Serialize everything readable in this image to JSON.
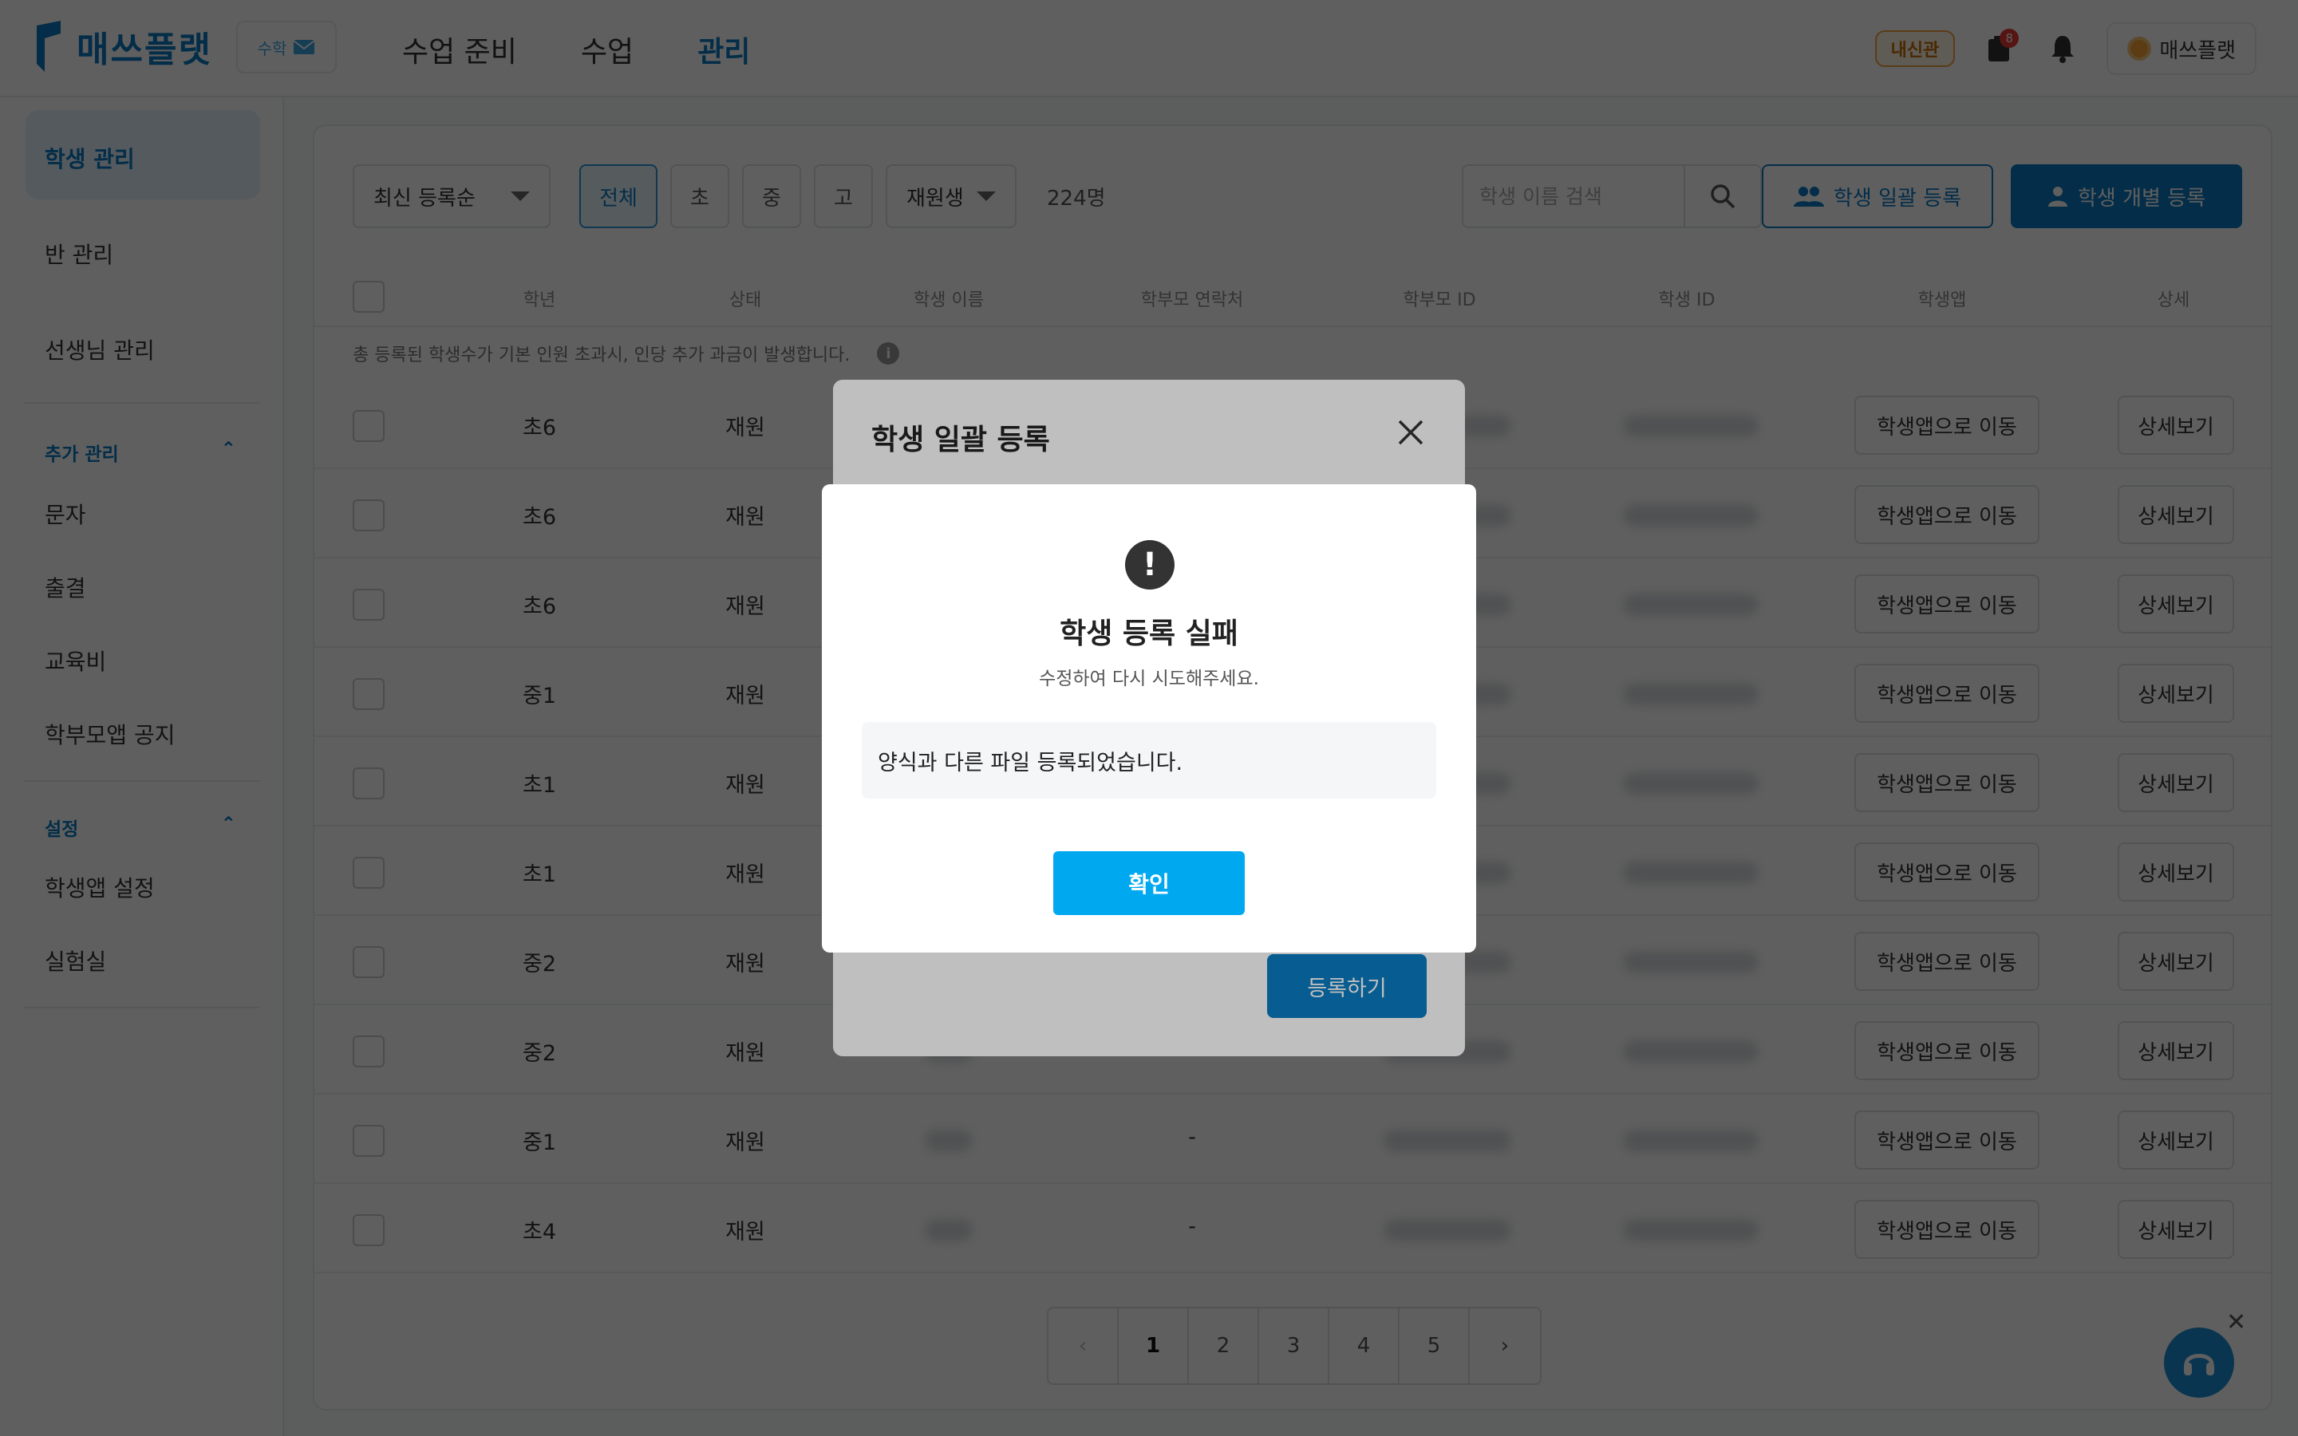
{
  "header": {
    "logo_text": "매쓰플랫",
    "badge_text": "수학",
    "nav": [
      "수업 준비",
      "수업",
      "관리"
    ],
    "tag": "내신관",
    "notif_count": "8",
    "profile_name": "매쓰플랫"
  },
  "sidebar": {
    "items": [
      "학생 관리",
      "반 관리",
      "선생님 관리"
    ],
    "group_extra": "추가 관리",
    "extra_items": [
      "문자",
      "출결",
      "교육비",
      "학부모앱 공지"
    ],
    "group_settings": "설정",
    "settings_items": [
      "학생앱 설정",
      "실험실"
    ]
  },
  "toolbar": {
    "sort": "최신 등록순",
    "filters": [
      "전체",
      "초",
      "중",
      "고"
    ],
    "status": "재원생",
    "count": "224명",
    "search_placeholder": "학생 이름 검색",
    "bulk_register": "학생 일괄 등록",
    "single_register": "학생 개별 등록"
  },
  "table": {
    "headers": [
      "학년",
      "상태",
      "학생 이름",
      "학부모 연락처",
      "학부모 ID",
      "학생 ID",
      "학생앱",
      "상세"
    ],
    "notice": "총 등록된 학생수가 기본 인원 초과시, 인당 추가 과금이 발생합니다.",
    "rows": [
      {
        "grade": "초6",
        "status": "재원",
        "parent_phone": ""
      },
      {
        "grade": "초6",
        "status": "재원",
        "parent_phone": ""
      },
      {
        "grade": "초6",
        "status": "재원",
        "parent_phone": ""
      },
      {
        "grade": "중1",
        "status": "재원",
        "parent_phone": ""
      },
      {
        "grade": "초1",
        "status": "재원",
        "parent_phone": ""
      },
      {
        "grade": "초1",
        "status": "재원",
        "parent_phone": ""
      },
      {
        "grade": "중2",
        "status": "재원",
        "parent_phone": ""
      },
      {
        "grade": "중2",
        "status": "재원",
        "parent_phone": ""
      },
      {
        "grade": "중1",
        "status": "재원",
        "parent_phone": "-"
      },
      {
        "grade": "초4",
        "status": "재원",
        "parent_phone": "-"
      }
    ],
    "app_button": "학생앱으로 이동",
    "detail_button": "상세보기"
  },
  "pagination": {
    "prev": "‹",
    "pages": [
      "1",
      "2",
      "3",
      "4",
      "5"
    ],
    "next": "›",
    "current": "1"
  },
  "bulk_modal": {
    "title": "학생 일괄 등록",
    "submit": "등록하기"
  },
  "alert": {
    "icon_text": "!",
    "title": "학생 등록 실패",
    "subtitle": "수정하여 다시 시도해주세요.",
    "message": "양식과 다른 파일 등록되었습니다.",
    "confirm": "확인"
  },
  "colors": {
    "brand": "#0a7bc2",
    "confirm": "#00a8f0",
    "overlay": "rgba(0,0,0,0.5)"
  }
}
